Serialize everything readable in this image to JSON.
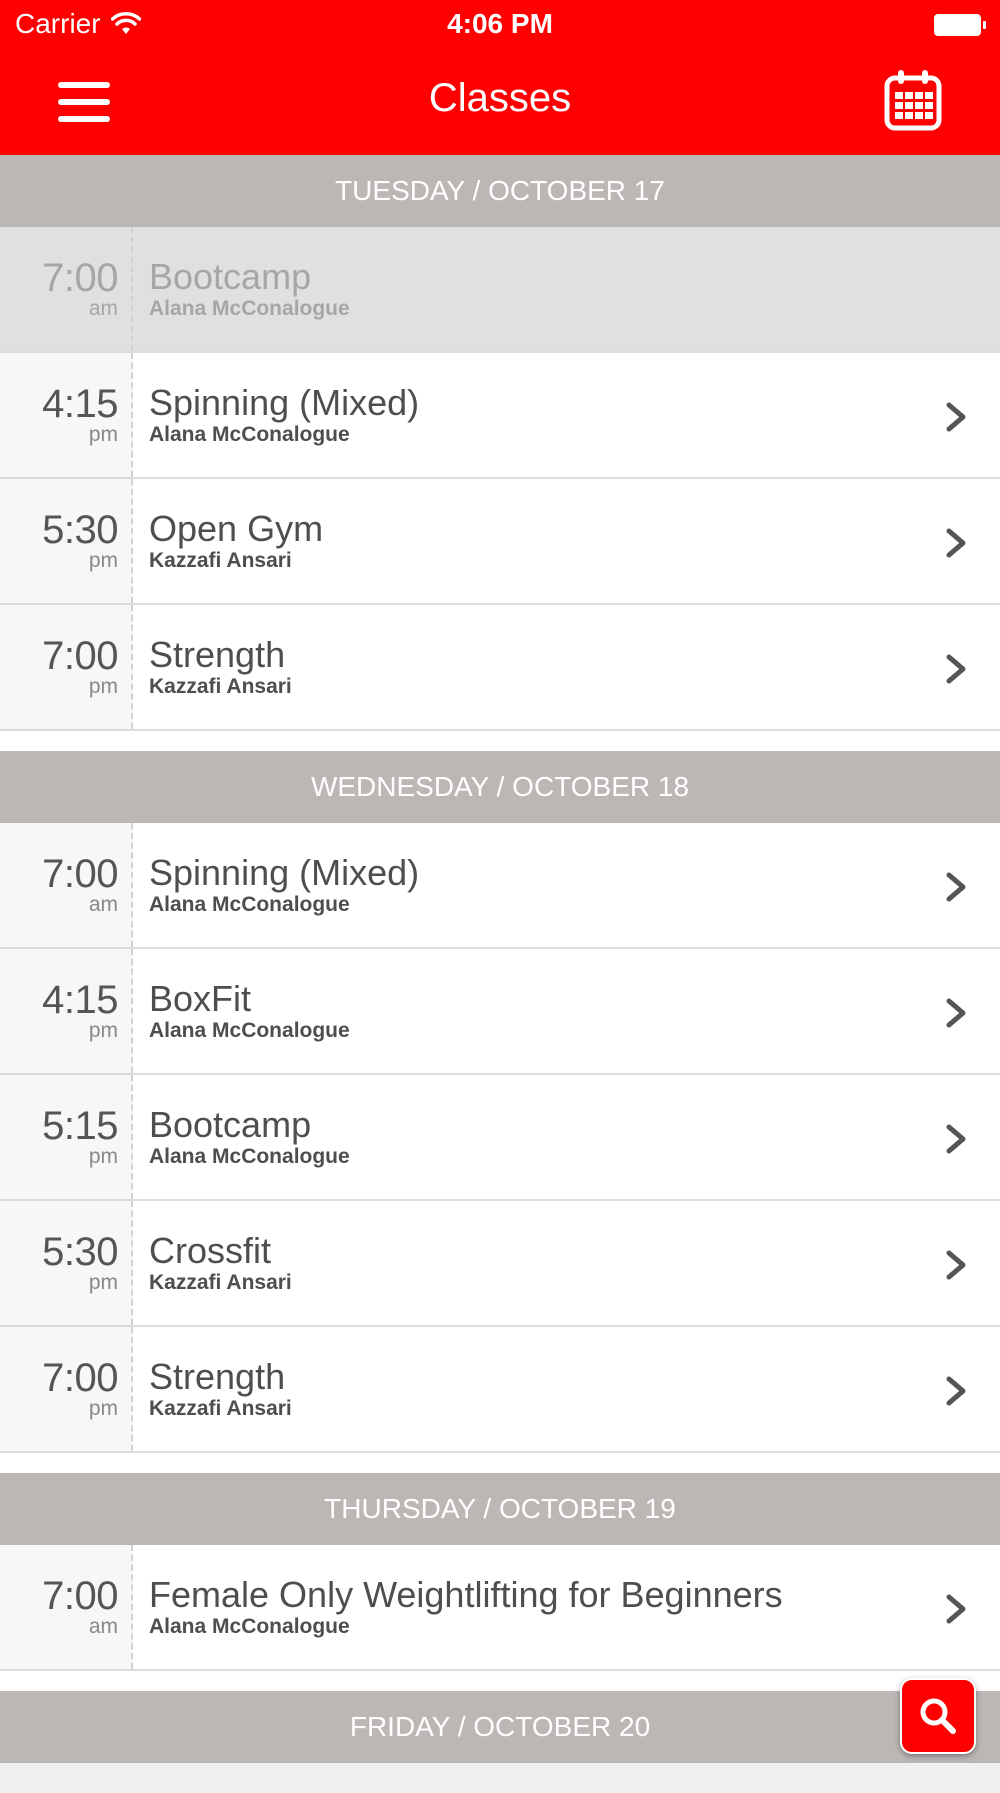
{
  "status_bar": {
    "carrier": "Carrier",
    "time": "4:06 PM"
  },
  "header": {
    "title": "Classes",
    "menu_icon": "hamburger-menu-icon",
    "calendar_icon": "calendar-icon"
  },
  "days": [
    {
      "label": "TUESDAY / OCTOBER 17",
      "classes": [
        {
          "time": "7:00",
          "ampm": "am",
          "name": "Bootcamp",
          "instructor": "Alana McConalogue",
          "past": true
        },
        {
          "time": "4:15",
          "ampm": "pm",
          "name": "Spinning (Mixed)",
          "instructor": "Alana McConalogue",
          "past": false
        },
        {
          "time": "5:30",
          "ampm": "pm",
          "name": "Open Gym",
          "instructor": "Kazzafi Ansari",
          "past": false
        },
        {
          "time": "7:00",
          "ampm": "pm",
          "name": "Strength",
          "instructor": "Kazzafi Ansari",
          "past": false
        }
      ]
    },
    {
      "label": "WEDNESDAY / OCTOBER 18",
      "classes": [
        {
          "time": "7:00",
          "ampm": "am",
          "name": "Spinning (Mixed)",
          "instructor": "Alana McConalogue",
          "past": false
        },
        {
          "time": "4:15",
          "ampm": "pm",
          "name": "BoxFit",
          "instructor": "Alana McConalogue",
          "past": false
        },
        {
          "time": "5:15",
          "ampm": "pm",
          "name": "Bootcamp",
          "instructor": "Alana McConalogue",
          "past": false
        },
        {
          "time": "5:30",
          "ampm": "pm",
          "name": "Crossfit",
          "instructor": "Kazzafi Ansari",
          "past": false
        },
        {
          "time": "7:00",
          "ampm": "pm",
          "name": "Strength",
          "instructor": "Kazzafi Ansari",
          "past": false
        }
      ]
    },
    {
      "label": "THURSDAY / OCTOBER 19",
      "classes": [
        {
          "time": "7:00",
          "ampm": "am",
          "name": "Female Only Weightlifting for Beginners",
          "instructor": "Alana McConalogue",
          "past": false
        }
      ]
    },
    {
      "label": "FRIDAY / OCTOBER 20",
      "classes": []
    }
  ],
  "fab": {
    "icon": "search-icon"
  },
  "colors": {
    "brand_red": "#ff0000",
    "day_header_bg": "#bcb6b5",
    "text_dark": "#4e4e4e",
    "past_bg": "#e0e0e0"
  }
}
